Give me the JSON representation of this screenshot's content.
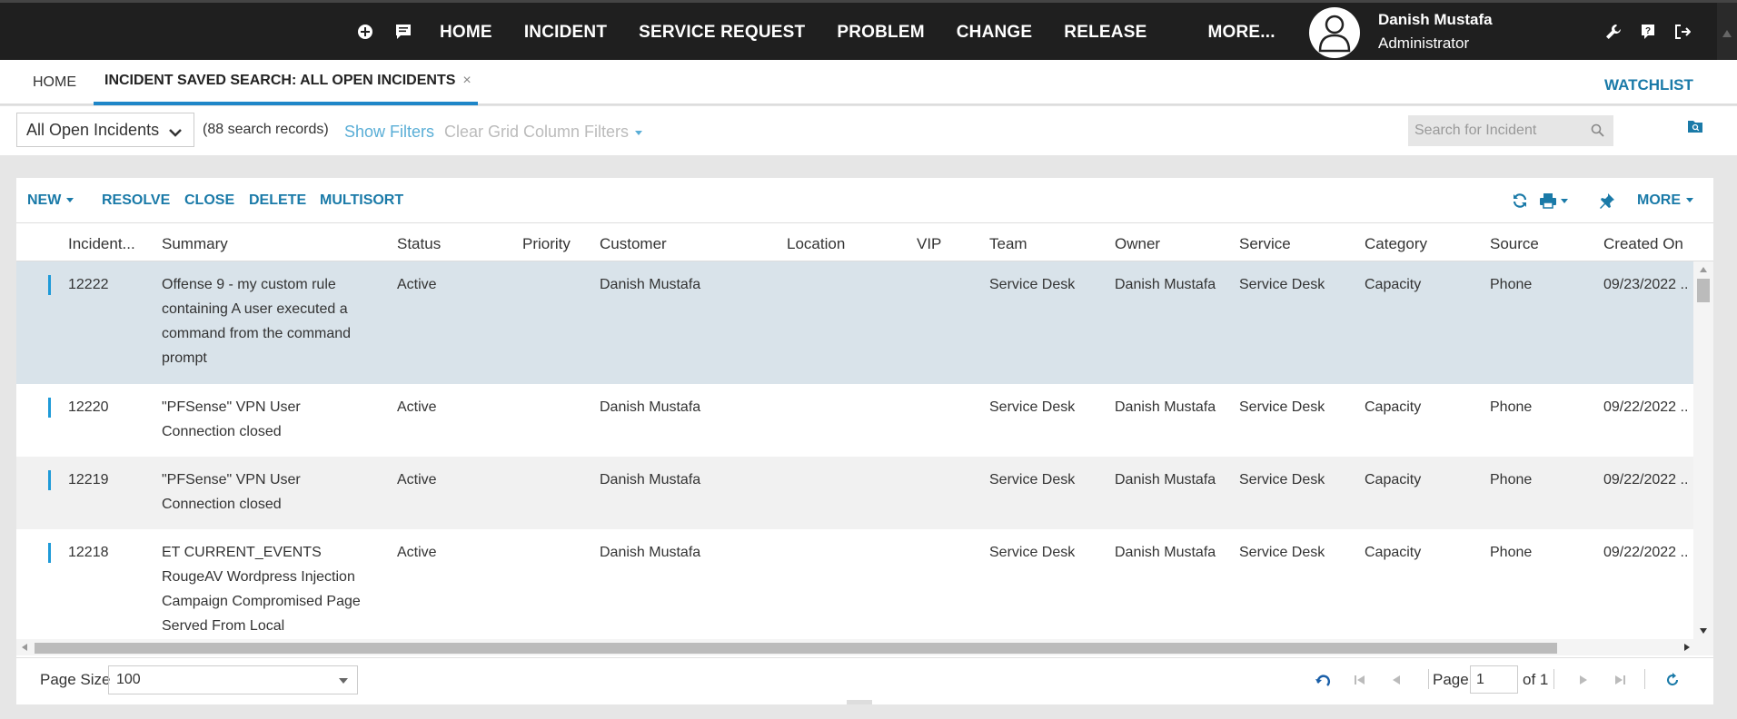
{
  "topnav": {
    "items": [
      "HOME",
      "INCIDENT",
      "SERVICE REQUEST",
      "PROBLEM",
      "CHANGE",
      "RELEASE"
    ],
    "more": "MORE...",
    "user_name": "Danish Mustafa",
    "user_role": "Administrator"
  },
  "tabs": {
    "home": "HOME",
    "active": "INCIDENT SAVED SEARCH: ALL OPEN INCIDENTS",
    "close": "×",
    "watchlist": "WATCHLIST"
  },
  "filters": {
    "saved_search": "All Open Incidents",
    "records": "(88 search records)",
    "show_filters": "Show Filters",
    "clear_filters": "Clear Grid Column Filters",
    "search_placeholder": "Search for Incident"
  },
  "toolbar": {
    "new": "NEW",
    "resolve": "RESOLVE",
    "close": "CLOSE",
    "delete": "DELETE",
    "multisort": "MULTISORT",
    "more": "MORE"
  },
  "grid": {
    "columns": [
      "Incident...",
      "Summary",
      "Status",
      "Priority",
      "Customer",
      "Location",
      "VIP",
      "Team",
      "Owner",
      "Service",
      "Category",
      "Source",
      "Created On"
    ],
    "rows": [
      {
        "id": "12222",
        "summary": "Offense 9 - my custom rule containing A user executed a command from the command prompt",
        "status": "Active",
        "priority": "",
        "customer": "Danish Mustafa",
        "location": "",
        "vip": "",
        "team": "Service Desk",
        "owner": "Danish Mustafa",
        "service": "Service Desk",
        "category": "Capacity",
        "source": "Phone",
        "created": "09/23/2022 .."
      },
      {
        "id": "12220",
        "summary": "\"PFSense\" VPN User Connection closed",
        "status": "Active",
        "priority": "",
        "customer": "Danish Mustafa",
        "location": "",
        "vip": "",
        "team": "Service Desk",
        "owner": "Danish Mustafa",
        "service": "Service Desk",
        "category": "Capacity",
        "source": "Phone",
        "created": "09/22/2022 .."
      },
      {
        "id": "12219",
        "summary": "\"PFSense\" VPN User Connection closed",
        "status": "Active",
        "priority": "",
        "customer": "Danish Mustafa",
        "location": "",
        "vip": "",
        "team": "Service Desk",
        "owner": "Danish Mustafa",
        "service": "Service Desk",
        "category": "Capacity",
        "source": "Phone",
        "created": "09/22/2022 .."
      },
      {
        "id": "12218",
        "summary": "ET CURRENT_EVENTS RougeAV Wordpress Injection Campaign Compromised Page Served From Local Compromised",
        "status": "Active",
        "priority": "",
        "customer": "Danish Mustafa",
        "location": "",
        "vip": "",
        "team": "Service Desk",
        "owner": "Danish Mustafa",
        "service": "Service Desk",
        "category": "Capacity",
        "source": "Phone",
        "created": "09/22/2022 .."
      }
    ]
  },
  "pager": {
    "page_size_label": "Page Size",
    "page_size": "100",
    "page_label": "Page",
    "page": "1",
    "of": "of 1"
  },
  "icons": {
    "accent": "#1a7aa8",
    "highlight": "#1e9ad8"
  }
}
